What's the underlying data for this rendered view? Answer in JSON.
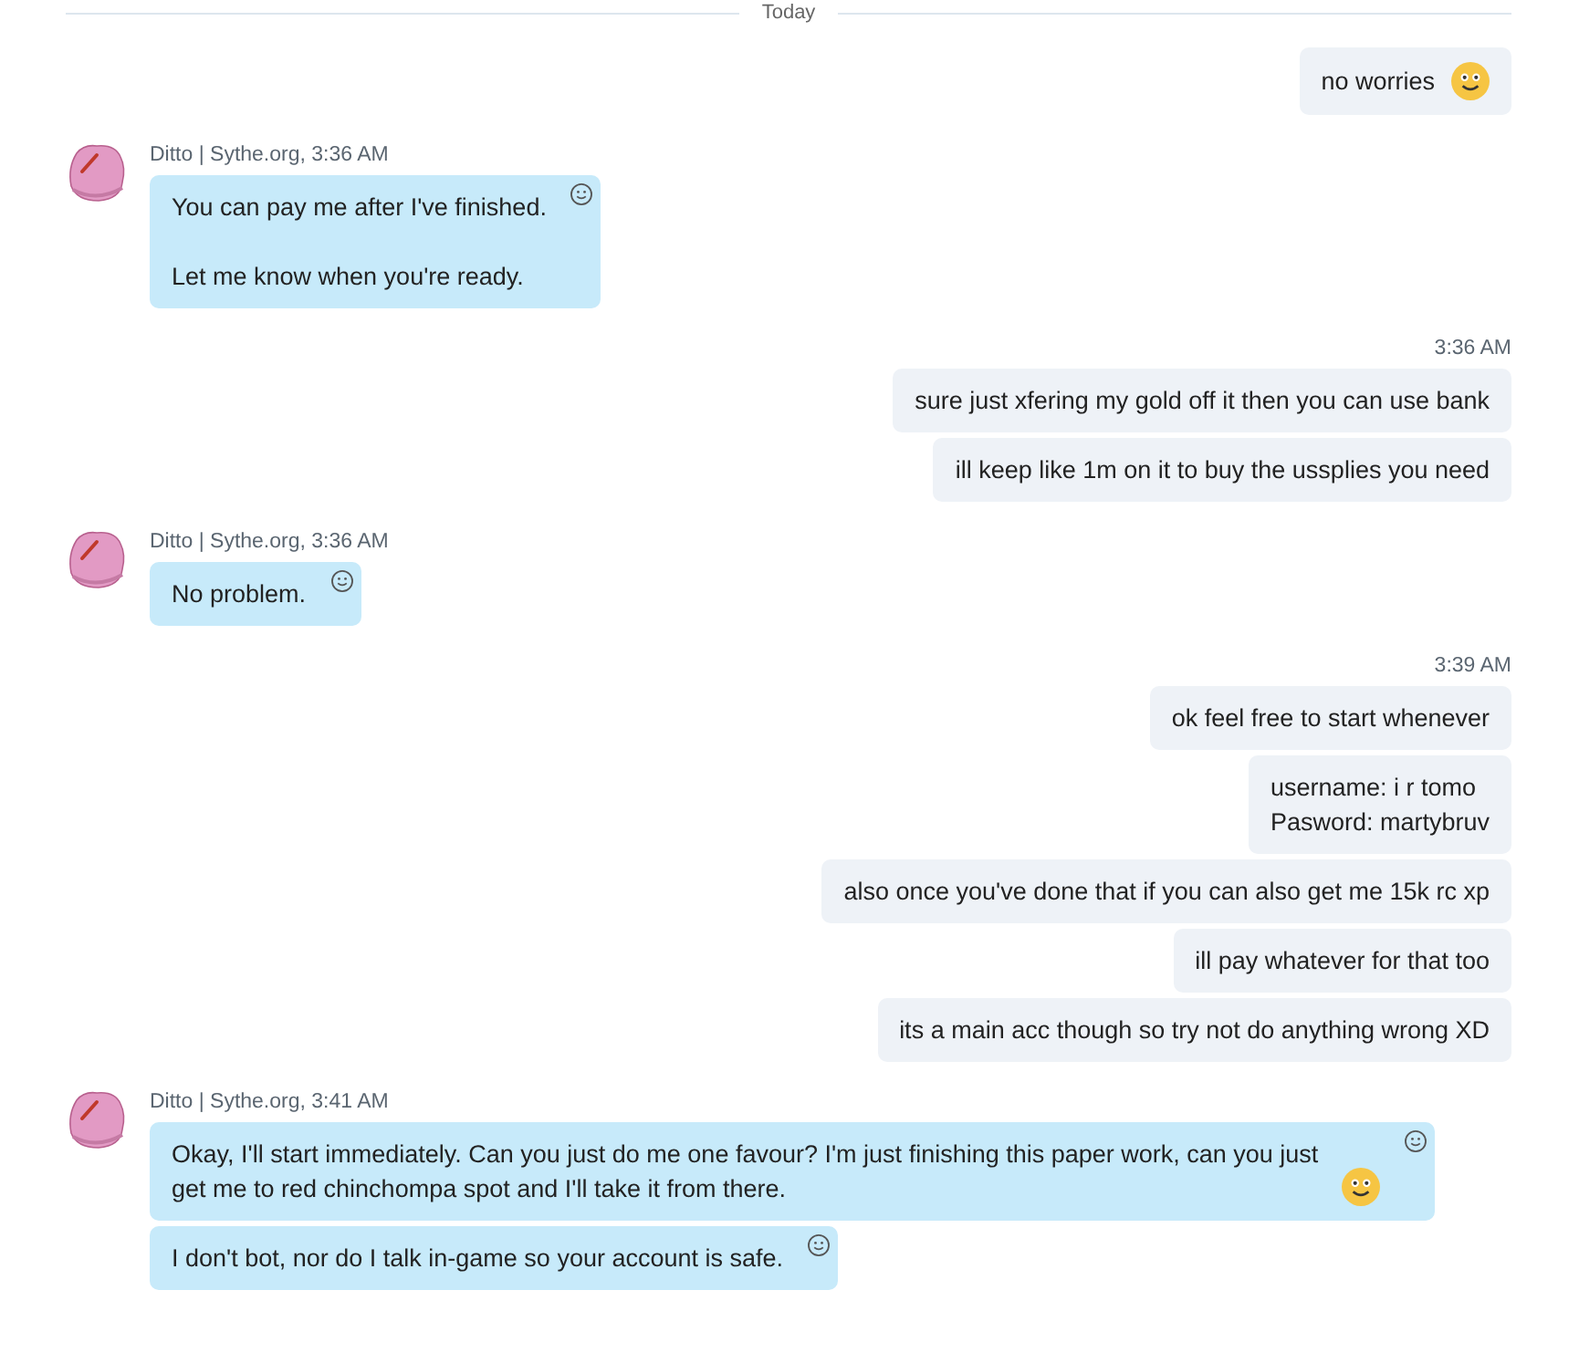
{
  "divider": {
    "label": "Today"
  },
  "groups": [
    {
      "kind": "outgoing",
      "messages": [
        {
          "text": "no worries",
          "emoji": true
        }
      ]
    },
    {
      "kind": "incoming",
      "sender": "Ditto | Sythe.org,",
      "time": "3:36 AM",
      "messages": [
        {
          "text": "You can pay me after I've finished.\n\nLet me know when you're ready.",
          "emoji": false,
          "reaction_button": true
        }
      ]
    },
    {
      "kind": "outgoing",
      "time": "3:36 AM",
      "messages": [
        {
          "text": "sure just xfering my gold off it then you can use bank",
          "emoji": false
        },
        {
          "text": "ill keep like 1m on it to buy the ussplies you need",
          "emoji": false
        }
      ]
    },
    {
      "kind": "incoming",
      "sender": "Ditto | Sythe.org,",
      "time": "3:36 AM",
      "messages": [
        {
          "text": "No problem.",
          "emoji": false,
          "reaction_button": true
        }
      ]
    },
    {
      "kind": "outgoing",
      "time": "3:39 AM",
      "messages": [
        {
          "text": "ok feel free to start whenever",
          "emoji": false
        },
        {
          "text": "username: i r tomo\nPasword: martybruv",
          "emoji": false
        },
        {
          "text": "also once you've done that if you can also get me 15k rc xp",
          "emoji": false
        },
        {
          "text": "ill pay whatever for that too",
          "emoji": false
        },
        {
          "text": "its a main acc though so try not do anything wrong XD",
          "emoji": false
        }
      ]
    },
    {
      "kind": "incoming",
      "sender": "Ditto | Sythe.org,",
      "time": "3:41 AM",
      "messages": [
        {
          "text": "Okay, I'll start immediately. Can you just do me one favour? I'm just finishing this paper work, can you just get me to red chinchompa spot and I'll take it from there.",
          "emoji": true,
          "reaction_button": true
        },
        {
          "text": "I don't bot, nor do I talk in-game so your account is safe.",
          "emoji": false,
          "reaction_button": true
        }
      ]
    }
  ]
}
